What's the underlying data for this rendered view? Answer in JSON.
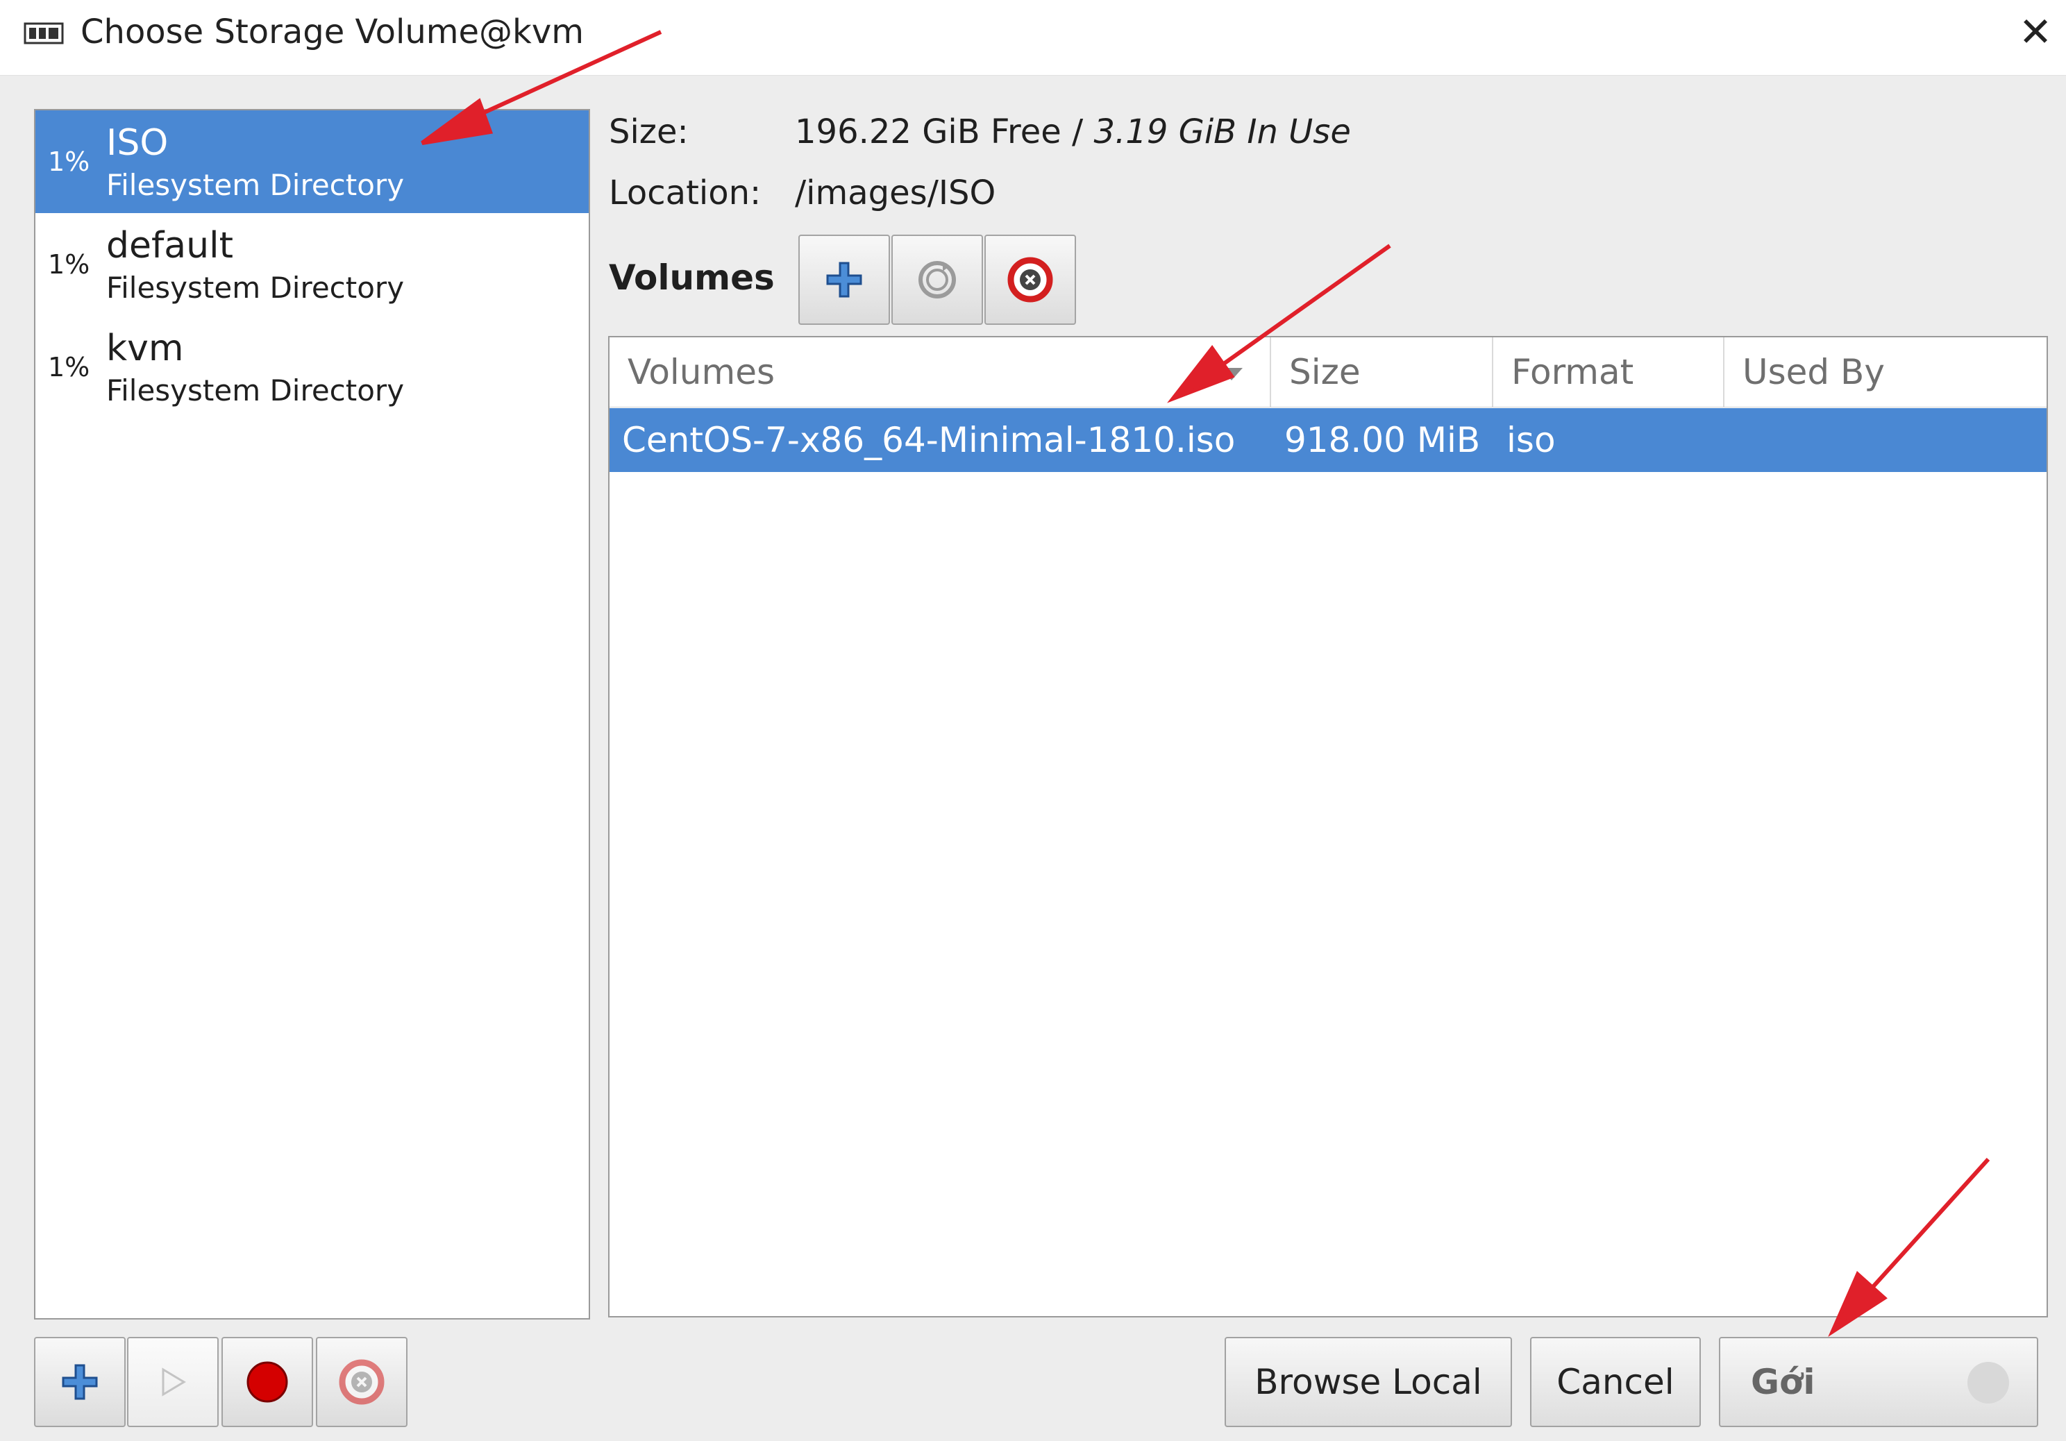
{
  "window": {
    "title": "Choose Storage Volume@kvm",
    "close_glyph": "✕",
    "icon": "storage-icon"
  },
  "pools": [
    {
      "usage": "1%",
      "name": "ISO",
      "type": "Filesystem Directory",
      "selected": true
    },
    {
      "usage": "1%",
      "name": "default",
      "type": "Filesystem Directory",
      "selected": false
    },
    {
      "usage": "1%",
      "name": "kvm",
      "type": "Filesystem Directory",
      "selected": false
    }
  ],
  "details": {
    "size_label": "Size:",
    "size_free": "196.22 GiB Free / ",
    "size_inuse": "3.19 GiB In Use",
    "location_label": "Location:",
    "location_value": "/images/ISO"
  },
  "volumes": {
    "title": "Volumes",
    "columns": [
      "Volumes",
      "Size",
      "Format",
      "Used By"
    ],
    "rows": [
      {
        "name": "CentOS-7-x86_64-Minimal-1810.iso",
        "size": "918.00 MiB",
        "format": "iso",
        "used_by": ""
      }
    ]
  },
  "buttons": {
    "browse_local": "Browse Local",
    "cancel": "Cancel",
    "choose": "Gới"
  },
  "colors": {
    "selection": "#4a88d3",
    "annotation_arrow": "#e0202a",
    "start_red": "#d40000"
  }
}
